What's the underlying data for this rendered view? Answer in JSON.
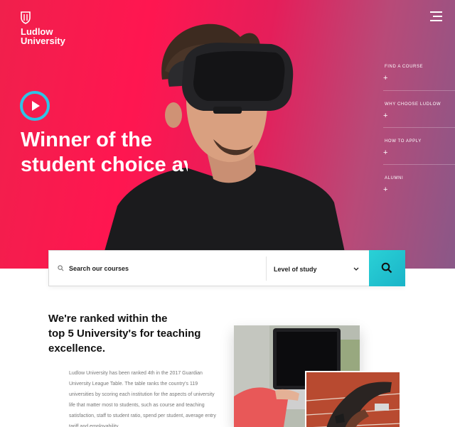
{
  "brand": {
    "name_line1": "Ludlow",
    "name_line2": "University"
  },
  "hero": {
    "headline_line1": "Winner of the",
    "headline_line2": "student choice av"
  },
  "side_nav": {
    "items": [
      {
        "label": "FIND A COURSE",
        "toggle": "+"
      },
      {
        "label": "WHY CHOOSE LUDLOW",
        "toggle": "+"
      },
      {
        "label": "HOW TO APPLY",
        "toggle": "+"
      },
      {
        "label": "ALUMNI",
        "toggle": "+"
      }
    ]
  },
  "search": {
    "placeholder": "Search our courses",
    "level_label": "Level of study"
  },
  "content": {
    "title_line1": "We're ranked within the",
    "title_line2": "top 5 University's for teaching",
    "title_line3": "excellence.",
    "body": "Ludlow University has been ranked 4th in the 2017 Guardian University League Table. The table ranks the country's 119 universities by scoring each institution for the aspects of university life that matter most to students, such as course and teaching satisfaction, staff to student ratio, spend per student, average entry tariff and employability."
  },
  "colors": {
    "hero_pink": "#ff1650",
    "hero_purple": "#8a5888",
    "accent_teal": "#2ad1d6",
    "play_ring": "#2ec4e6"
  },
  "icons": [
    "shield-logo-icon",
    "hamburger-menu-icon",
    "play-icon",
    "plus-icon",
    "search-icon",
    "chevron-down-icon"
  ]
}
